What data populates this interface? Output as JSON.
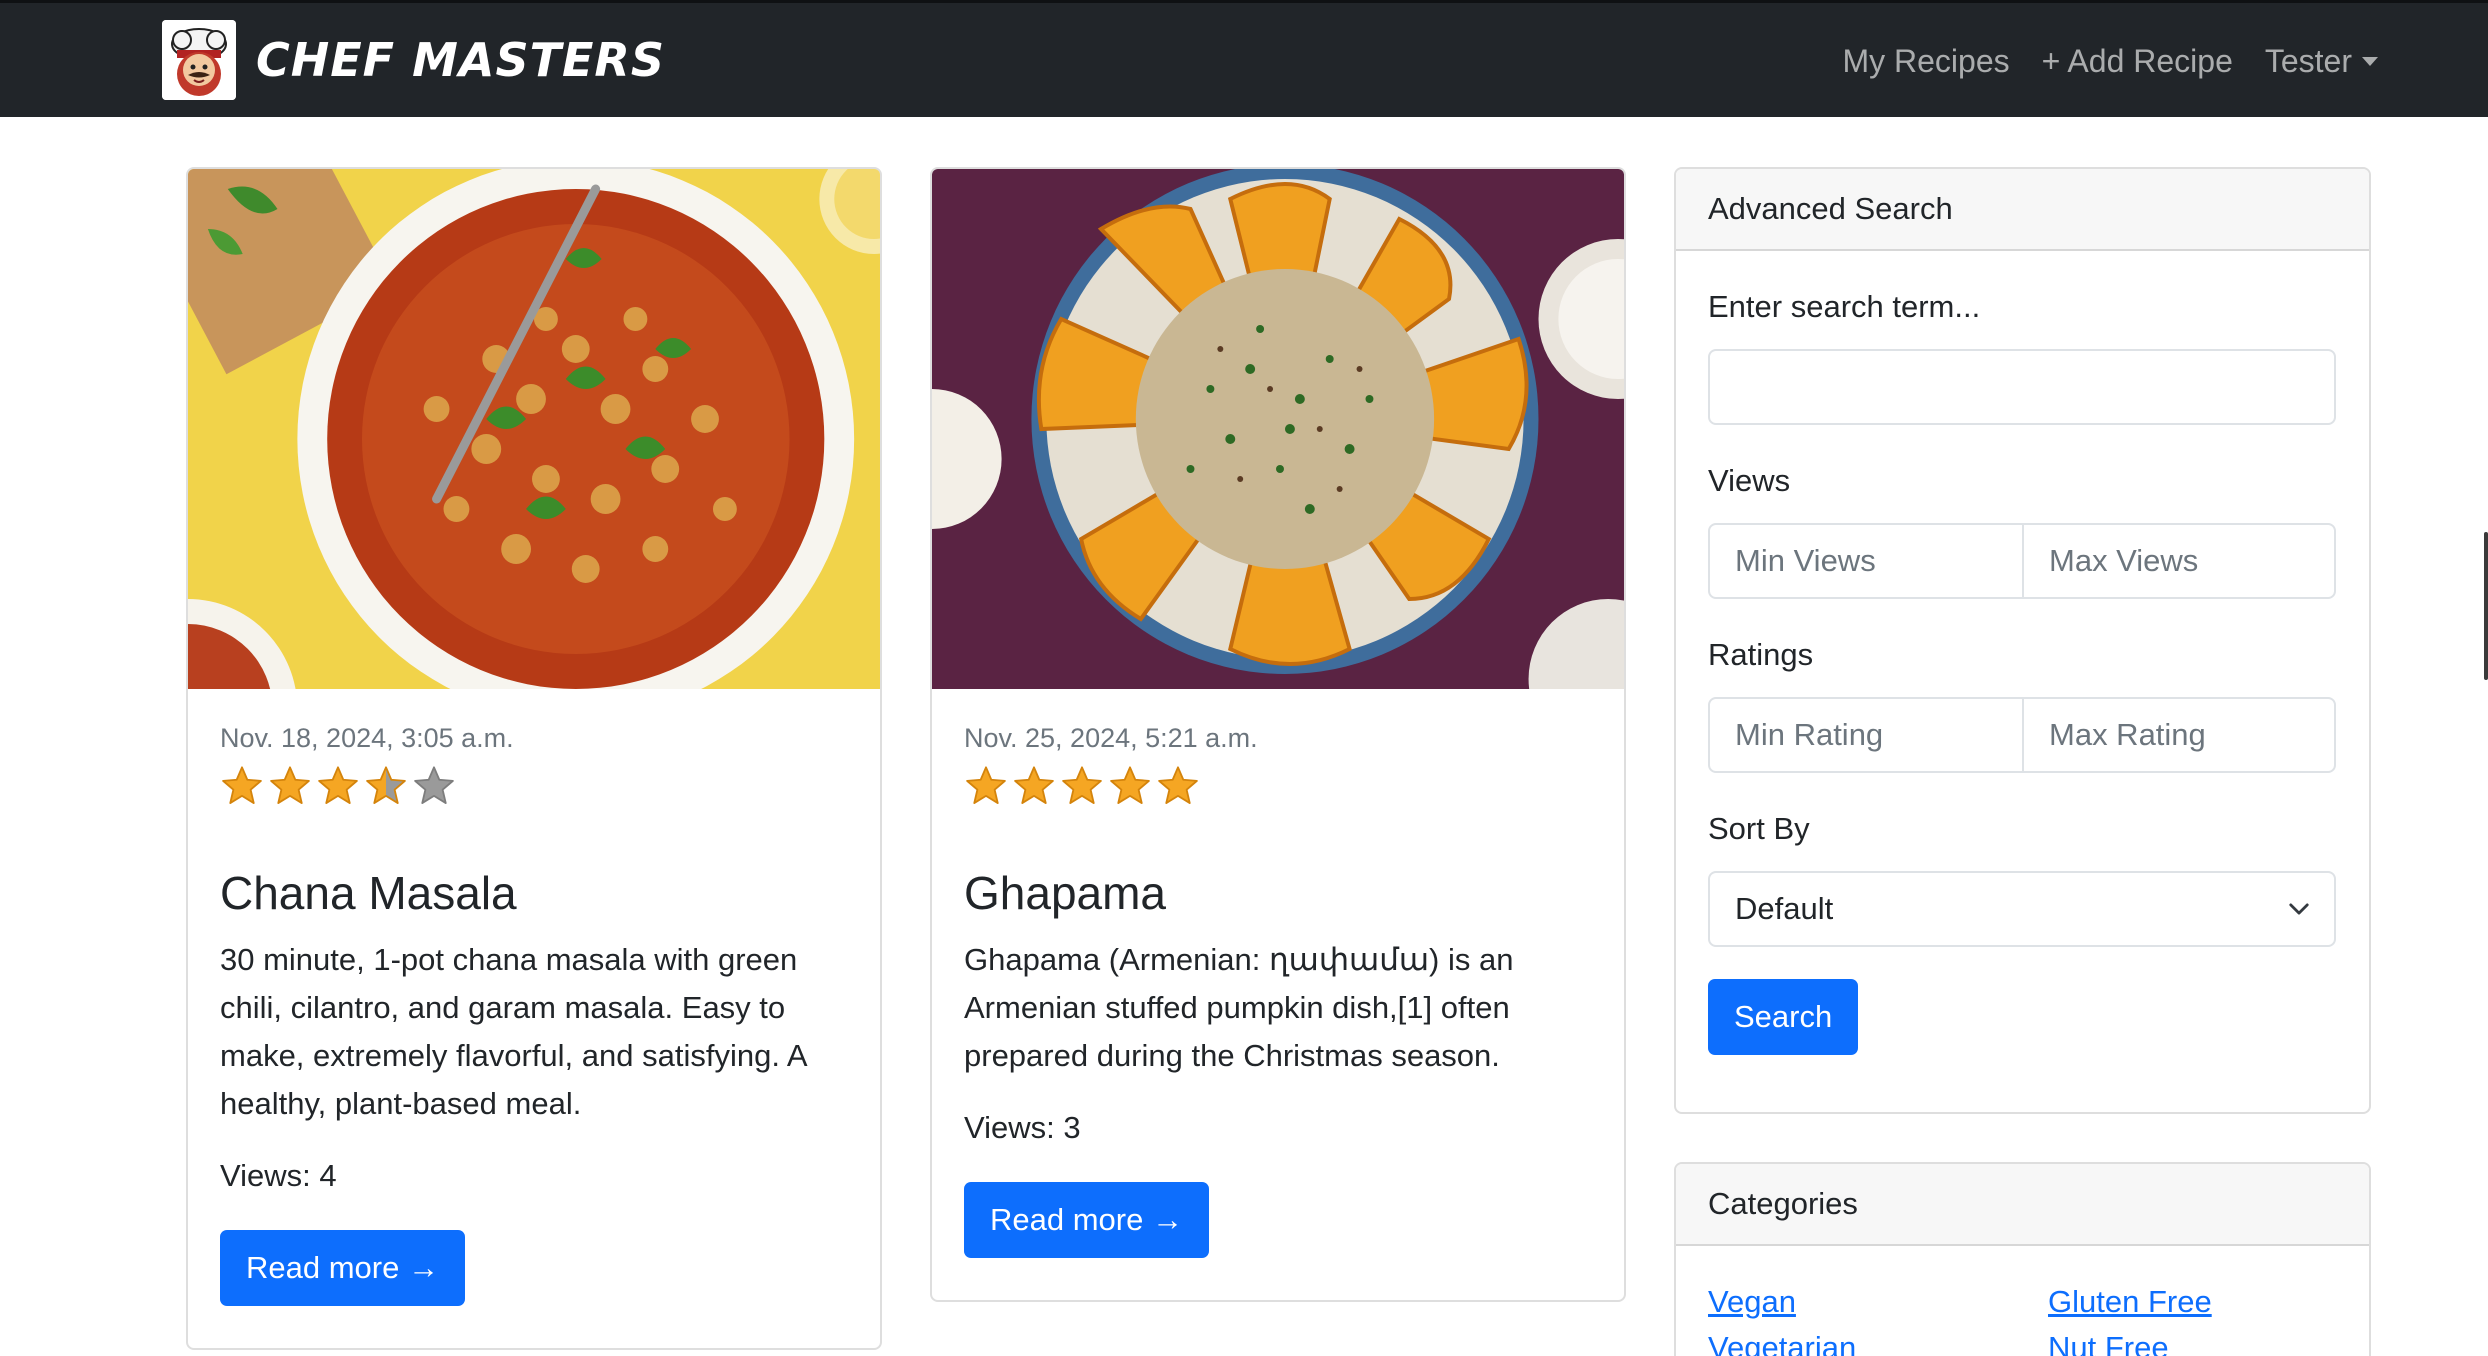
{
  "navbar": {
    "brand": "Chef Masters",
    "links": {
      "my_recipes": "My Recipes",
      "add_recipe": "+ Add Recipe",
      "user": "Tester"
    }
  },
  "recipes": [
    {
      "date": "Nov. 18, 2024, 3:05 a.m.",
      "rating": 3.5,
      "title": "Chana Masala",
      "description": "30 minute, 1-pot chana masala with green chili, cilantro, and garam masala. Easy to make, extremely flavorful, and satisfying. A healthy, plant-based meal.",
      "views": "Views: 4",
      "button": "Read more →"
    },
    {
      "date": "Nov. 25, 2024, 5:21 a.m.",
      "rating": 5,
      "title": "Ghapama",
      "description": "Ghapama (Armenian: ղափամա) is an Armenian stuffed pumpkin dish,[1] often prepared during the Christmas season.",
      "views": "Views: 3",
      "button": "Read more →"
    }
  ],
  "search": {
    "header": "Advanced Search",
    "term_label": "Enter search term...",
    "term_value": "",
    "views_label": "Views",
    "min_views_placeholder": "Min Views",
    "max_views_placeholder": "Max Views",
    "ratings_label": "Ratings",
    "min_rating_placeholder": "Min Rating",
    "max_rating_placeholder": "Max Rating",
    "sort_label": "Sort By",
    "sort_value": "Default",
    "button": "Search"
  },
  "categories": {
    "header": "Categories",
    "items": [
      "Vegan",
      "Gluten Free",
      "Vegetarian",
      "Nut Free"
    ]
  },
  "colors": {
    "navbar": "#212529",
    "primary": "#0d6efd",
    "star": "#f5a623"
  }
}
